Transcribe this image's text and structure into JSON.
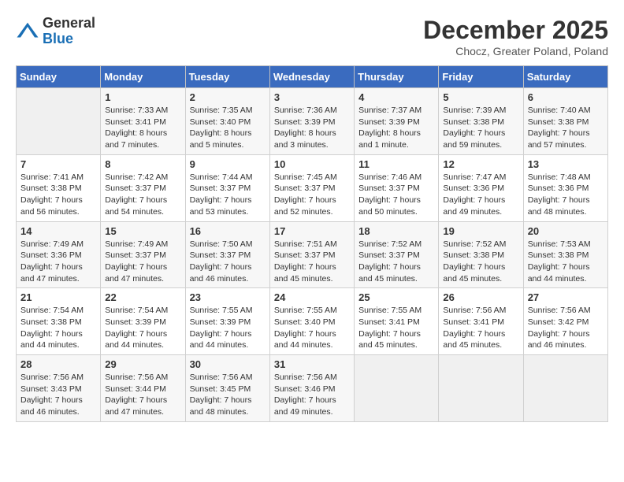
{
  "header": {
    "logo_general": "General",
    "logo_blue": "Blue",
    "month_title": "December 2025",
    "location": "Chocz, Greater Poland, Poland"
  },
  "days_of_week": [
    "Sunday",
    "Monday",
    "Tuesday",
    "Wednesday",
    "Thursday",
    "Friday",
    "Saturday"
  ],
  "weeks": [
    [
      {
        "day": "",
        "info": ""
      },
      {
        "day": "1",
        "info": "Sunrise: 7:33 AM\nSunset: 3:41 PM\nDaylight: 8 hours\nand 7 minutes."
      },
      {
        "day": "2",
        "info": "Sunrise: 7:35 AM\nSunset: 3:40 PM\nDaylight: 8 hours\nand 5 minutes."
      },
      {
        "day": "3",
        "info": "Sunrise: 7:36 AM\nSunset: 3:39 PM\nDaylight: 8 hours\nand 3 minutes."
      },
      {
        "day": "4",
        "info": "Sunrise: 7:37 AM\nSunset: 3:39 PM\nDaylight: 8 hours\nand 1 minute."
      },
      {
        "day": "5",
        "info": "Sunrise: 7:39 AM\nSunset: 3:38 PM\nDaylight: 7 hours\nand 59 minutes."
      },
      {
        "day": "6",
        "info": "Sunrise: 7:40 AM\nSunset: 3:38 PM\nDaylight: 7 hours\nand 57 minutes."
      }
    ],
    [
      {
        "day": "7",
        "info": "Sunrise: 7:41 AM\nSunset: 3:38 PM\nDaylight: 7 hours\nand 56 minutes."
      },
      {
        "day": "8",
        "info": "Sunrise: 7:42 AM\nSunset: 3:37 PM\nDaylight: 7 hours\nand 54 minutes."
      },
      {
        "day": "9",
        "info": "Sunrise: 7:44 AM\nSunset: 3:37 PM\nDaylight: 7 hours\nand 53 minutes."
      },
      {
        "day": "10",
        "info": "Sunrise: 7:45 AM\nSunset: 3:37 PM\nDaylight: 7 hours\nand 52 minutes."
      },
      {
        "day": "11",
        "info": "Sunrise: 7:46 AM\nSunset: 3:37 PM\nDaylight: 7 hours\nand 50 minutes."
      },
      {
        "day": "12",
        "info": "Sunrise: 7:47 AM\nSunset: 3:36 PM\nDaylight: 7 hours\nand 49 minutes."
      },
      {
        "day": "13",
        "info": "Sunrise: 7:48 AM\nSunset: 3:36 PM\nDaylight: 7 hours\nand 48 minutes."
      }
    ],
    [
      {
        "day": "14",
        "info": "Sunrise: 7:49 AM\nSunset: 3:36 PM\nDaylight: 7 hours\nand 47 minutes."
      },
      {
        "day": "15",
        "info": "Sunrise: 7:49 AM\nSunset: 3:37 PM\nDaylight: 7 hours\nand 47 minutes."
      },
      {
        "day": "16",
        "info": "Sunrise: 7:50 AM\nSunset: 3:37 PM\nDaylight: 7 hours\nand 46 minutes."
      },
      {
        "day": "17",
        "info": "Sunrise: 7:51 AM\nSunset: 3:37 PM\nDaylight: 7 hours\nand 45 minutes."
      },
      {
        "day": "18",
        "info": "Sunrise: 7:52 AM\nSunset: 3:37 PM\nDaylight: 7 hours\nand 45 minutes."
      },
      {
        "day": "19",
        "info": "Sunrise: 7:52 AM\nSunset: 3:38 PM\nDaylight: 7 hours\nand 45 minutes."
      },
      {
        "day": "20",
        "info": "Sunrise: 7:53 AM\nSunset: 3:38 PM\nDaylight: 7 hours\nand 44 minutes."
      }
    ],
    [
      {
        "day": "21",
        "info": "Sunrise: 7:54 AM\nSunset: 3:38 PM\nDaylight: 7 hours\nand 44 minutes."
      },
      {
        "day": "22",
        "info": "Sunrise: 7:54 AM\nSunset: 3:39 PM\nDaylight: 7 hours\nand 44 minutes."
      },
      {
        "day": "23",
        "info": "Sunrise: 7:55 AM\nSunset: 3:39 PM\nDaylight: 7 hours\nand 44 minutes."
      },
      {
        "day": "24",
        "info": "Sunrise: 7:55 AM\nSunset: 3:40 PM\nDaylight: 7 hours\nand 44 minutes."
      },
      {
        "day": "25",
        "info": "Sunrise: 7:55 AM\nSunset: 3:41 PM\nDaylight: 7 hours\nand 45 minutes."
      },
      {
        "day": "26",
        "info": "Sunrise: 7:56 AM\nSunset: 3:41 PM\nDaylight: 7 hours\nand 45 minutes."
      },
      {
        "day": "27",
        "info": "Sunrise: 7:56 AM\nSunset: 3:42 PM\nDaylight: 7 hours\nand 46 minutes."
      }
    ],
    [
      {
        "day": "28",
        "info": "Sunrise: 7:56 AM\nSunset: 3:43 PM\nDaylight: 7 hours\nand 46 minutes."
      },
      {
        "day": "29",
        "info": "Sunrise: 7:56 AM\nSunset: 3:44 PM\nDaylight: 7 hours\nand 47 minutes."
      },
      {
        "day": "30",
        "info": "Sunrise: 7:56 AM\nSunset: 3:45 PM\nDaylight: 7 hours\nand 48 minutes."
      },
      {
        "day": "31",
        "info": "Sunrise: 7:56 AM\nSunset: 3:46 PM\nDaylight: 7 hours\nand 49 minutes."
      },
      {
        "day": "",
        "info": ""
      },
      {
        "day": "",
        "info": ""
      },
      {
        "day": "",
        "info": ""
      }
    ]
  ]
}
